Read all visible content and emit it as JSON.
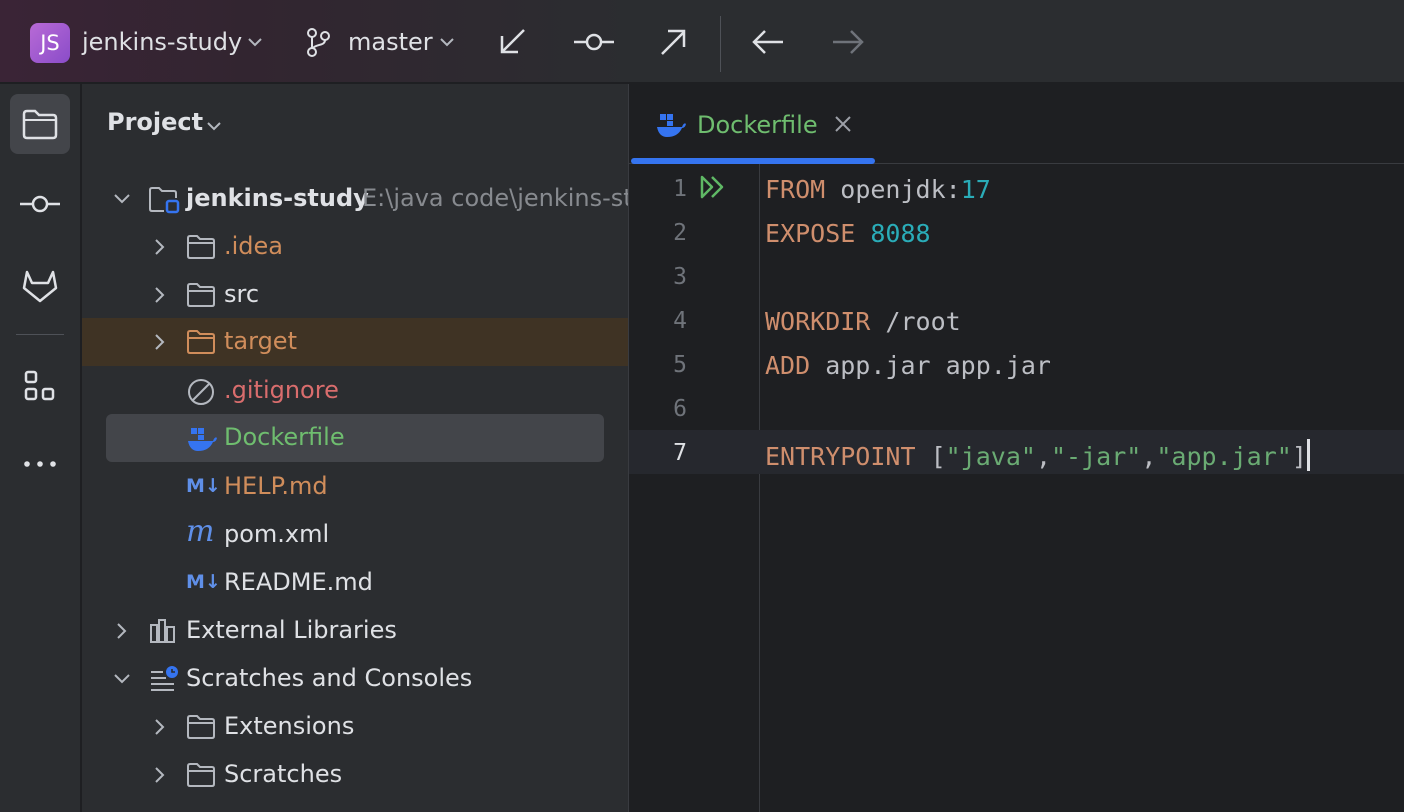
{
  "toolbar": {
    "project_badge": "JS",
    "project_name": "jenkins-study",
    "branch": "master"
  },
  "panel": {
    "title": "Project",
    "tree": {
      "root": {
        "name": "jenkins-study",
        "path": "E:\\java code\\jenkins-stu"
      },
      "idea": ".idea",
      "src": "src",
      "target": "target",
      "gitignore": ".gitignore",
      "dockerfile": "Dockerfile",
      "help": "HELP.md",
      "pom": "pom.xml",
      "readme": "README.md",
      "external": "External Libraries",
      "scratches_root": "Scratches and Consoles",
      "extensions": "Extensions",
      "scratches": "Scratches"
    }
  },
  "editor": {
    "tab_label": "Dockerfile",
    "lines": [
      {
        "n": "1",
        "kw": "FROM",
        "rest": " openjdk:",
        "num": "17"
      },
      {
        "n": "2",
        "kw": "EXPOSE",
        "num": "8088"
      },
      {
        "n": "3"
      },
      {
        "n": "4",
        "kw": "WORKDIR",
        "rest": " /root"
      },
      {
        "n": "5",
        "kw": "ADD",
        "rest": " app.jar app.jar"
      },
      {
        "n": "6"
      },
      {
        "n": "7",
        "kw": "ENTRYPOINT",
        "open": " [",
        "s1": "\"java\"",
        "c1": ",",
        "s2": "\"-jar\"",
        "c2": ",",
        "s3": "\"app.jar\"",
        "close": "]"
      }
    ]
  },
  "colors": {
    "accent": "#3574f0",
    "keyword": "#cf8e6d",
    "number": "#2aacb8",
    "string": "#6aab73",
    "vcs_added": "#6fbd6f",
    "vcs_ignored": "#d08d5b"
  }
}
